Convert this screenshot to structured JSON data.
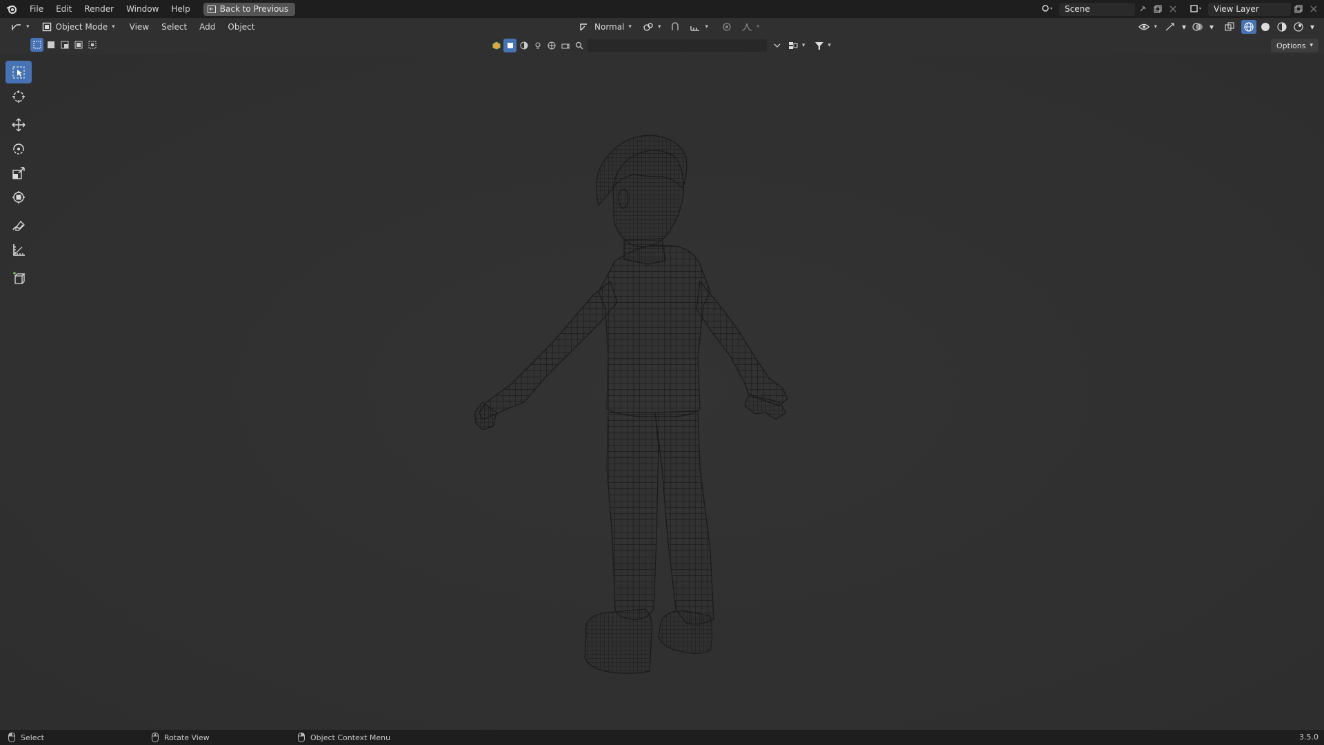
{
  "menubar": {
    "items": [
      "File",
      "Edit",
      "Render",
      "Window",
      "Help"
    ],
    "back_button": "Back to Previous",
    "scene_field": "Scene",
    "view_layer_field": "View Layer"
  },
  "header": {
    "mode": "Object Mode",
    "menus": [
      "View",
      "Select",
      "Add",
      "Object"
    ],
    "orientation": "Normal"
  },
  "viewport": {
    "options_label": "Options",
    "search_placeholder": ""
  },
  "toolbar": {
    "tools": [
      "select-box",
      "cursor",
      "move",
      "rotate",
      "scale",
      "transform",
      "annotate",
      "measure",
      "add-cube"
    ],
    "active": "select-box"
  },
  "statusbar": {
    "left": "Select",
    "middle": "Rotate View",
    "right": "Object Context Menu",
    "version": "3.5.0"
  },
  "colors": {
    "accent": "#4772b3",
    "background": "#303030",
    "bar": "#1e1e1e"
  }
}
